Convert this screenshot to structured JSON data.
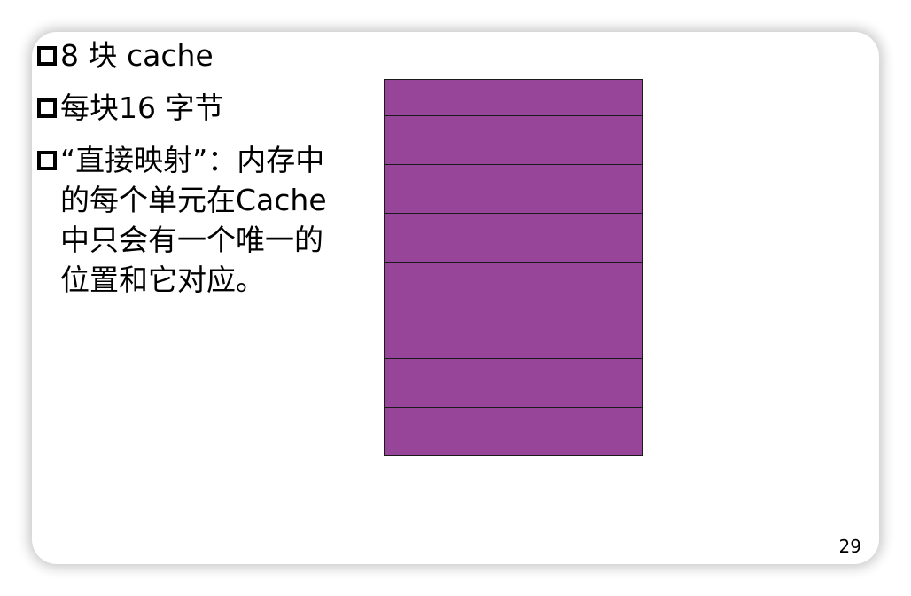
{
  "slide": {
    "bullets": [
      "8 块 cache",
      "每块16 字节",
      "“直接映射”：内存中的每个单元在Cache中只会有一个唯一的位置和它对应。"
    ],
    "page_number": "29"
  },
  "cache_diagram": {
    "block_count": 8,
    "block_color": "#974599",
    "line_color": "#1a1a1a"
  }
}
